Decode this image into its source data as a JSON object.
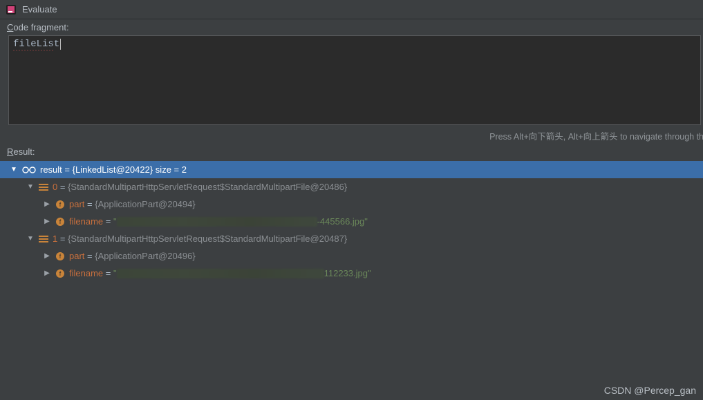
{
  "window": {
    "title": "Evaluate"
  },
  "labels": {
    "codeFragment": "Code fragment:",
    "result": "Result:",
    "navigateHint": "Press Alt+向下箭头, Alt+向上箭头 to navigate through th"
  },
  "code": {
    "expression": "fileList"
  },
  "result": {
    "root": {
      "name": "result",
      "eq": "=",
      "value": "{LinkedList@20422}  size = 2"
    },
    "items": [
      {
        "index": "0",
        "value": "{StandardMultipartHttpServletRequest$StandardMultipartFile@20486}",
        "fields": [
          {
            "name": "part",
            "value": "{ApplicationPart@20494}"
          },
          {
            "name": "filename",
            "valuePrefix": "\"",
            "valueSuffix": "-445566.jpg\""
          }
        ]
      },
      {
        "index": "1",
        "value": "{StandardMultipartHttpServletRequest$StandardMultipartFile@20487}",
        "fields": [
          {
            "name": "part",
            "value": "{ApplicationPart@20496}"
          },
          {
            "name": "filename",
            "valuePrefix": "\"",
            "valueSuffix": "112233.jpg\""
          }
        ]
      }
    ]
  },
  "watermark": "CSDN @Percep_gan"
}
